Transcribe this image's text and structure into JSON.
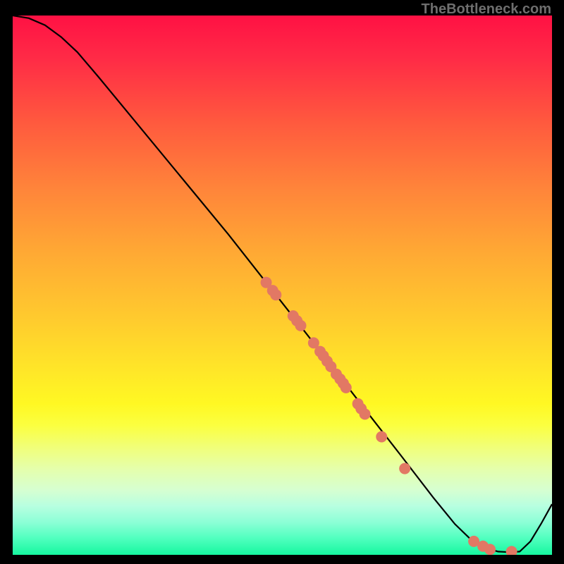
{
  "watermark": "TheBottleneck.com",
  "chart_data": {
    "type": "line",
    "title": "",
    "xlabel": "",
    "ylabel": "",
    "xlim": [
      0,
      100
    ],
    "ylim": [
      0,
      100
    ],
    "grid": false,
    "curve": [
      {
        "x": 0,
        "y": 100
      },
      {
        "x": 3,
        "y": 99.5
      },
      {
        "x": 6,
        "y": 98.2
      },
      {
        "x": 9,
        "y": 96.0
      },
      {
        "x": 12,
        "y": 93.2
      },
      {
        "x": 16,
        "y": 88.5
      },
      {
        "x": 24,
        "y": 78.8
      },
      {
        "x": 32,
        "y": 69.1
      },
      {
        "x": 40,
        "y": 59.4
      },
      {
        "x": 47,
        "y": 50.5
      },
      {
        "x": 54,
        "y": 41.6
      },
      {
        "x": 60,
        "y": 33.9
      },
      {
        "x": 66,
        "y": 26.1
      },
      {
        "x": 72,
        "y": 18.4
      },
      {
        "x": 78,
        "y": 10.6
      },
      {
        "x": 82,
        "y": 5.7
      },
      {
        "x": 85,
        "y": 2.8
      },
      {
        "x": 88,
        "y": 1.2
      },
      {
        "x": 90,
        "y": 0.6
      },
      {
        "x": 92,
        "y": 0.5
      },
      {
        "x": 94,
        "y": 0.6
      },
      {
        "x": 96,
        "y": 2.5
      },
      {
        "x": 98,
        "y": 5.8
      },
      {
        "x": 100,
        "y": 9.4
      }
    ],
    "points": [
      {
        "x": 47.0,
        "y": 50.5
      },
      {
        "x": 48.2,
        "y": 49.0
      },
      {
        "x": 48.8,
        "y": 48.2
      },
      {
        "x": 52.0,
        "y": 44.3
      },
      {
        "x": 52.7,
        "y": 43.4
      },
      {
        "x": 53.4,
        "y": 42.5
      },
      {
        "x": 55.8,
        "y": 39.3
      },
      {
        "x": 57.0,
        "y": 37.7
      },
      {
        "x": 57.6,
        "y": 36.9
      },
      {
        "x": 58.3,
        "y": 35.9
      },
      {
        "x": 59.0,
        "y": 34.9
      },
      {
        "x": 60.0,
        "y": 33.5
      },
      {
        "x": 60.7,
        "y": 32.6
      },
      {
        "x": 61.3,
        "y": 31.8
      },
      {
        "x": 61.8,
        "y": 31.0
      },
      {
        "x": 64.0,
        "y": 28.0
      },
      {
        "x": 64.6,
        "y": 27.1
      },
      {
        "x": 65.3,
        "y": 26.1
      },
      {
        "x": 68.4,
        "y": 21.9
      },
      {
        "x": 72.7,
        "y": 16.0
      },
      {
        "x": 85.5,
        "y": 2.5
      },
      {
        "x": 87.2,
        "y": 1.6
      },
      {
        "x": 88.5,
        "y": 1.0
      },
      {
        "x": 92.5,
        "y": 0.6
      }
    ],
    "colors": {
      "curve": "#000000",
      "points": "#e27864"
    }
  }
}
